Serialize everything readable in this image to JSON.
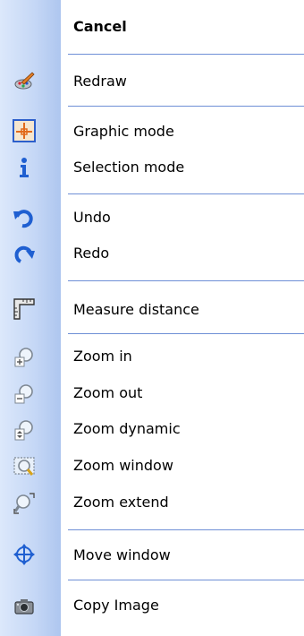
{
  "menu": {
    "items": [
      {
        "label": "Cancel",
        "icon": "none"
      },
      {
        "label": "Redraw",
        "icon": "paint-brush-icon"
      },
      {
        "label": "Graphic mode",
        "icon": "crosshair-frame-icon"
      },
      {
        "label": "Selection mode",
        "icon": "info-icon"
      },
      {
        "label": "Undo",
        "icon": "undo-arrow-icon"
      },
      {
        "label": "Redo",
        "icon": "redo-arrow-icon"
      },
      {
        "label": "Measure distance",
        "icon": "ruler-icon"
      },
      {
        "label": "Zoom in",
        "icon": "zoom-in-icon"
      },
      {
        "label": "Zoom out",
        "icon": "zoom-out-icon"
      },
      {
        "label": "Zoom dynamic",
        "icon": "zoom-dynamic-icon"
      },
      {
        "label": "Zoom window",
        "icon": "zoom-window-icon"
      },
      {
        "label": "Zoom extend",
        "icon": "zoom-extend-icon"
      },
      {
        "label": "Move window",
        "icon": "move-arrows-icon"
      },
      {
        "label": "Copy Image",
        "icon": "camera-icon"
      }
    ]
  },
  "colors": {
    "gutter": "#c6d8f6",
    "separator": "#6f8fd6",
    "icon_blue": "#1f5fd1",
    "icon_orange": "#e26a1c"
  }
}
